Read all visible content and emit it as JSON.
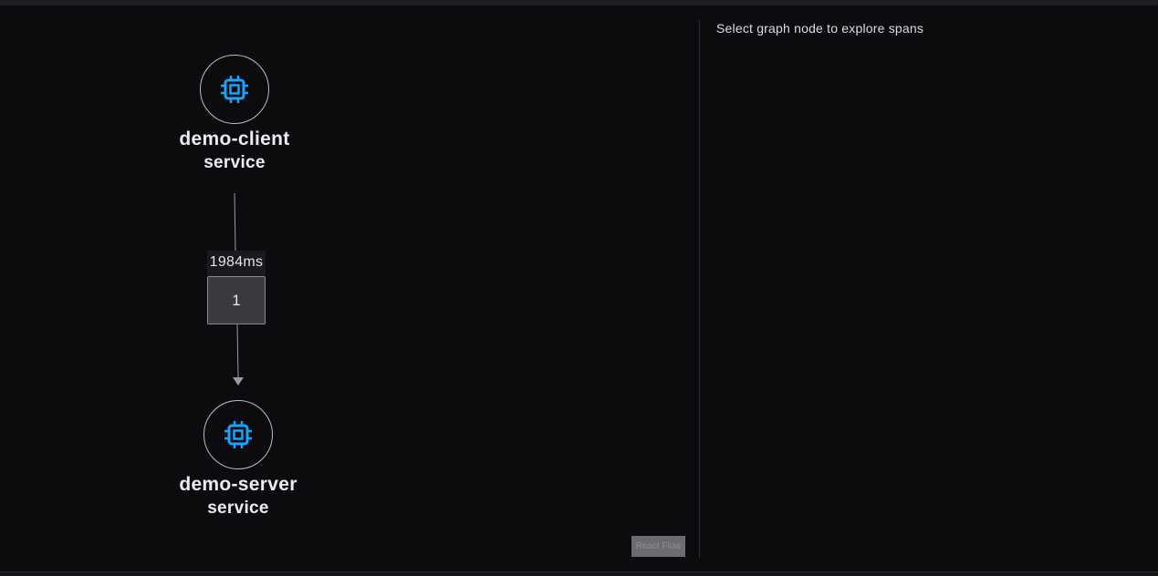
{
  "graph": {
    "nodes": [
      {
        "name": "demo-client",
        "type": "service",
        "icon": "cpu-chip-icon"
      },
      {
        "name": "demo-server",
        "type": "service",
        "icon": "cpu-chip-icon"
      }
    ],
    "edge": {
      "duration_label": "1984ms",
      "count_label": "1"
    },
    "attribution": "React Flow"
  },
  "details": {
    "hint": "Select graph node to explore spans"
  },
  "colors": {
    "icon_accent": "#1aa3ff",
    "background": "#0c0c0f",
    "edge_stroke": "#9a9aa0"
  }
}
